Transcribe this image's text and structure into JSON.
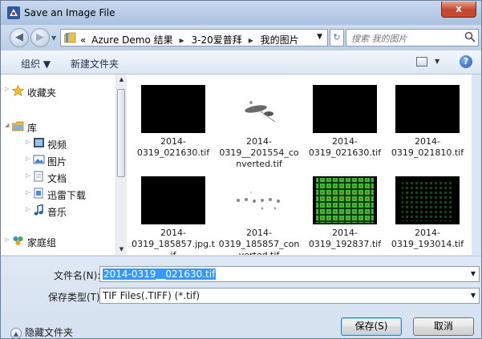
{
  "window": {
    "title": "Save an Image File",
    "close_label": "x"
  },
  "nav": {
    "back_label": "◀",
    "forward_label": "▶",
    "breadcrumbs": [
      "«",
      "Azure Demo 结果",
      "3-20爱普拜",
      "我的图片"
    ],
    "search_placeholder": "搜索 我的图片"
  },
  "toolbar": {
    "organize_label": "组织 ▼",
    "new_folder_label": "新建文件夹"
  },
  "sidebar": {
    "favorites": "收藏夹",
    "library": "库",
    "library_items": [
      "视频",
      "图片",
      "文档",
      "迅雷下载",
      "音乐"
    ],
    "homegroup": "家庭组"
  },
  "files": [
    {
      "name": "2014-0319_021630.tif",
      "thumb": "black"
    },
    {
      "name": "2014-0319__201554_converted.tif",
      "thumb": "smudge"
    },
    {
      "name": "2014-0319_021630.tif",
      "thumb": "black"
    },
    {
      "name": "2014-0319_021810.tif",
      "thumb": "black"
    },
    {
      "name": "2014-0319_185857.jpg.tif",
      "thumb": "black"
    },
    {
      "name": "2014-0319_185857_converted.tif",
      "thumb": "dots"
    },
    {
      "name": "2014-0319_192837.tif",
      "thumb": "green-grid"
    },
    {
      "name": "2014-0319_193014.tif",
      "thumb": "dark-green"
    }
  ],
  "form": {
    "filename_label": "文件名(N):",
    "filename_value": "2014-0319__021630.tif",
    "filetype_label": "保存类型(T):",
    "filetype_value": "TIF Files(.TIFF) (*.tif)"
  },
  "footer": {
    "hide_folders_label": "隐藏文件夹",
    "save_label": "保存(S)",
    "cancel_label": "取消"
  },
  "colors": {
    "accent": "#3399ff",
    "titlebar": "#a9c1e0",
    "close": "#c94a2e"
  }
}
